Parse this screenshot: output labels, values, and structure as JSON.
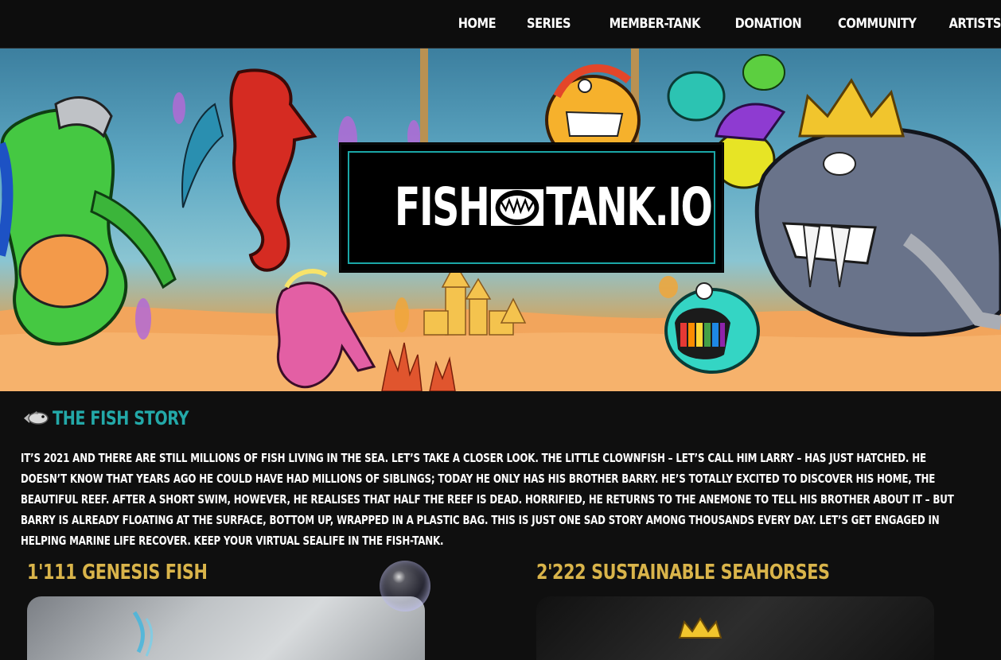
{
  "nav": {
    "items": [
      "HOME",
      "SERIES",
      "MEMBER-TANK",
      "DONATION",
      "COMMUNITY",
      "ARTISTS"
    ]
  },
  "hero": {
    "logo_left": "FISH",
    "logo_right": "TANK.IO"
  },
  "story": {
    "title": "THE FISH STORY",
    "icon": "fish-icon",
    "text": "IT’S 2021 AND THERE ARE STILL MILLIONS OF FISH LIVING IN THE SEA. LET’S TAKE A CLOSER LOOK. THE LITTLE CLOWNFISH – LET’S CALL HIM LARRY – HAS JUST HATCHED. HE DOESN’T KNOW THAT YEARS AGO HE COULD HAVE HAD MILLIONS OF SIBLINGS; TODAY HE ONLY HAS HIS BROTHER BARRY. HE’S TOTALLY EXCITED TO DISCOVER HIS HOME, THE BEAUTIFUL REEF. AFTER A SHORT SWIM, HOWEVER, HE REALISES THAT HALF THE REEF IS DEAD. HORRIFIED, HE RETURNS TO THE ANEMONE TO TELL HIS BROTHER ABOUT IT – BUT BARRY IS ALREADY FLOATING AT THE SURFACE, BOTTOM UP, WRAPPED IN A PLASTIC BAG. THIS IS JUST ONE SAD STORY AMONG THOUSANDS EVERY DAY. LET’S GET ENGAGED IN HELPING MARINE LIFE RECOVER. KEEP YOUR VIRTUAL SEALIFE IN THE FISH-TANK."
  },
  "series": {
    "genesis_title": "1'111 GENESIS FISH",
    "seahorse_title": "2'222 SUSTAINABLE SEAHORSES"
  },
  "colors": {
    "accent_teal": "#23a8a8",
    "accent_gold": "#d9b44a",
    "background": "#0f0f0f"
  }
}
